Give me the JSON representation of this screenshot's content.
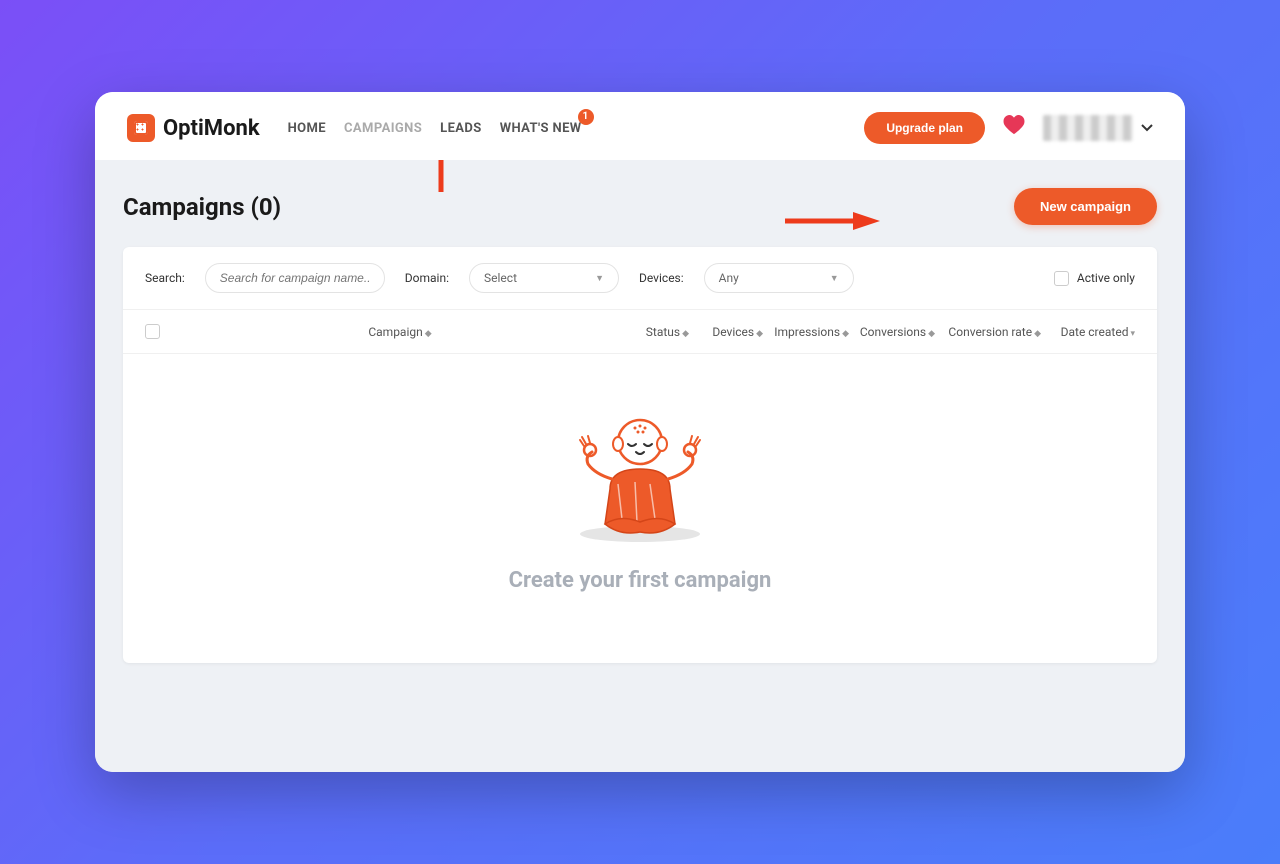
{
  "brand": "OptiMonk",
  "nav": {
    "home": "HOME",
    "campaigns": "CAMPAIGNS",
    "leads": "LEADS",
    "whatsnew": "WHAT'S NEW",
    "whatsnew_badge": "1"
  },
  "header": {
    "upgrade_label": "Upgrade plan"
  },
  "page": {
    "title": "Campaigns (0)",
    "new_campaign_label": "New campaign"
  },
  "filters": {
    "search_label": "Search:",
    "search_placeholder": "Search for campaign name...",
    "domain_label": "Domain:",
    "domain_value": "Select",
    "devices_label": "Devices:",
    "devices_value": "Any",
    "active_only_label": "Active only"
  },
  "table": {
    "campaign": "Campaign",
    "status": "Status",
    "devices": "Devices",
    "impressions": "Impressions",
    "conversions": "Conversions",
    "rate": "Conversion rate",
    "date": "Date created"
  },
  "empty": {
    "message": "Create your first campaign"
  },
  "colors": {
    "accent": "#ed5a29"
  }
}
